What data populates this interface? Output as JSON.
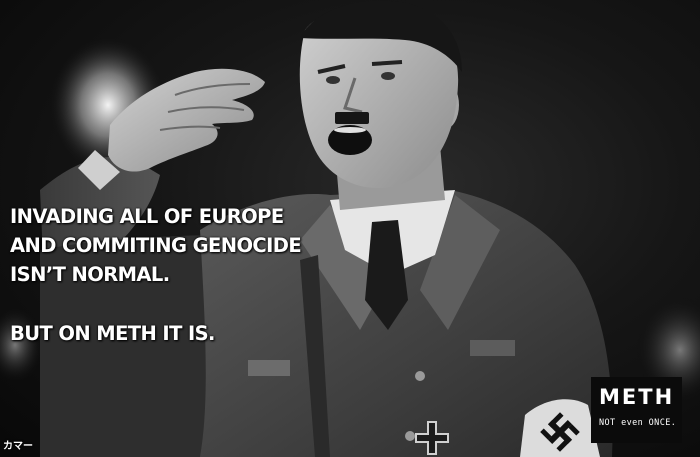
{
  "headline": {
    "lines": [
      "INVADING ALL OF EUROPE",
      "AND COMMITING GENOCIDE",
      "ISN’T NORMAL."
    ]
  },
  "punchline": "BUT ON METH IT IS.",
  "logo": {
    "word": "METH",
    "tagline": "NOT even ONCE."
  },
  "watermark": "カマー",
  "photo": {
    "subject": "black-and-white photo of a uniformed man giving a raised-arm salute while shouting",
    "palette": {
      "background": "#101010",
      "skin": "#b8b8b8",
      "uniform": "#4a4a4a",
      "shirt": "#e6e6e6",
      "tie": "#1a1a1a"
    }
  }
}
